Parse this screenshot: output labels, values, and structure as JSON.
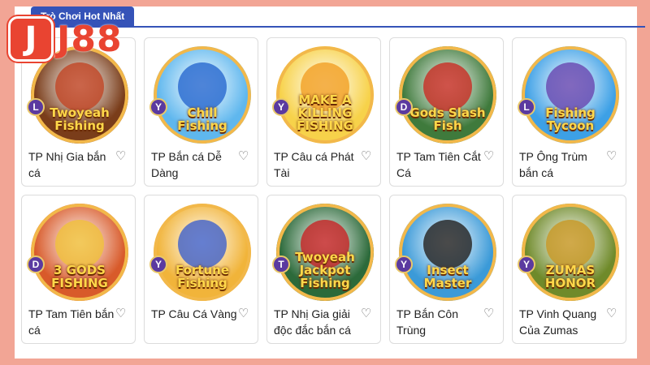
{
  "section": {
    "title": "Trò Chơi Hot Nhất"
  },
  "brand": {
    "mark": "J",
    "name": "J88",
    "color": "#e94431"
  },
  "colors": {
    "page_bg": "#f2a595",
    "tab": "#3553b8"
  },
  "games": [
    {
      "name": "TP Nhị Gia bắn cá",
      "logo": "Twoyeah\nFishing",
      "badge": "L",
      "bg": "#7a3d1a",
      "art": "#c14a2a",
      "icon": "heart-icon"
    },
    {
      "name": "TP Bắn cá Dễ Dàng",
      "logo": "Chill\nFishing",
      "badge": "Y",
      "bg": "#5fb7ee",
      "art": "#2f6fd1",
      "icon": "heart-icon"
    },
    {
      "name": "TP Câu cá Phát Tài",
      "logo": "MAKE A\nKILLING\nFISHING",
      "badge": "Y",
      "bg": "#f7d24a",
      "art": "#f2a32c",
      "icon": "heart-icon"
    },
    {
      "name": "TP Tam Tiên Cắt Cá",
      "logo": "Gods Slash Fish",
      "badge": "D",
      "bg": "#3f7a3c",
      "art": "#c7352a",
      "icon": "heart-icon"
    },
    {
      "name": "TP Ông Trùm bắn cá",
      "logo": "Fishing\nTycoon",
      "badge": "L",
      "bg": "#3da0e6",
      "art": "#6b4db3",
      "icon": "heart-icon"
    },
    {
      "name": "TP Tam Tiên bắn cá",
      "logo": "3 GODS FISHING",
      "badge": "D",
      "bg": "#d85a2a",
      "art": "#f0c040",
      "icon": "heart-icon"
    },
    {
      "name": "TP Câu Cá Vàng",
      "logo": "Fortune\nFishing",
      "badge": "Y",
      "bg": "#f1b43a",
      "art": "#4a67c8",
      "icon": "heart-icon"
    },
    {
      "name": "TP Nhị Gia giải độc đắc bắn cá",
      "logo": "Twoyeah\nJackpot Fishing",
      "badge": "T",
      "bg": "#2c6a3a",
      "art": "#c42b2b",
      "icon": "heart-icon"
    },
    {
      "name": "TP Bắn Côn Trùng",
      "logo": "Insect\nMaster",
      "badge": "Y",
      "bg": "#3b9ad8",
      "art": "#2a2a2a",
      "icon": "heart-icon"
    },
    {
      "name": "TP Vinh Quang Của Zumas",
      "logo": "ZUMAS\nHONOR",
      "badge": "Y",
      "bg": "#6f8a2a",
      "art": "#c89a2a",
      "icon": "heart-icon"
    }
  ]
}
